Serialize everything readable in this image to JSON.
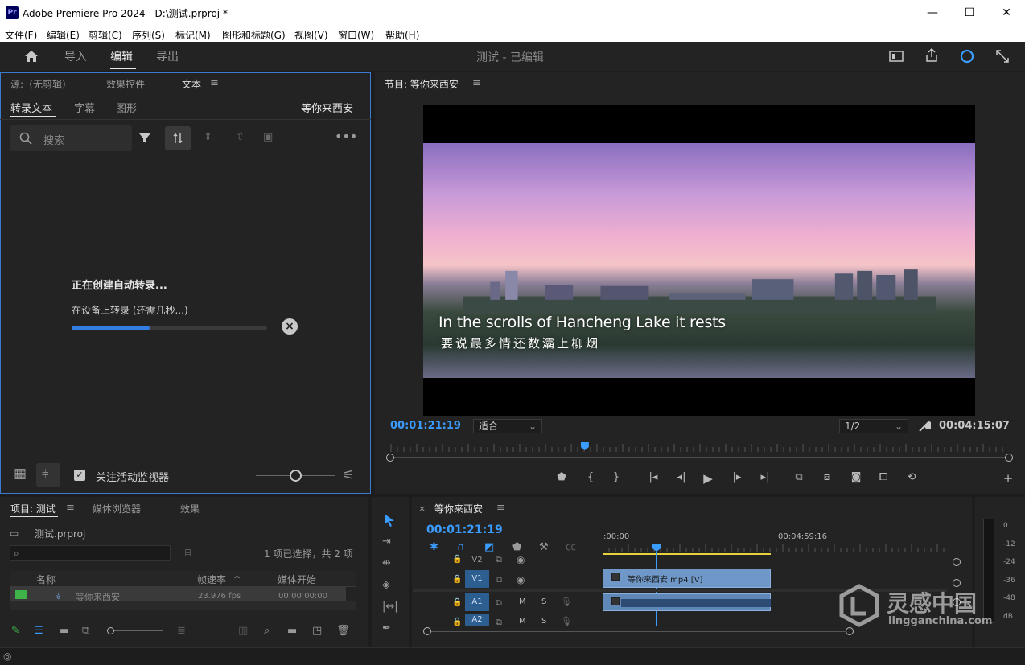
{
  "window": {
    "title": "Adobe Premiere Pro 2024 - D:\\测试.prproj *",
    "logo": "Pr",
    "minimize": "—",
    "maximize": "☐",
    "close": "✕"
  },
  "menu": [
    "文件(F)",
    "编辑(E)",
    "剪辑(C)",
    "序列(S)",
    "标记(M)",
    "图形和标题(G)",
    "视图(V)",
    "窗口(W)",
    "帮助(H)"
  ],
  "header": {
    "tabs": [
      "导入",
      "编辑",
      "导出"
    ],
    "active_tab": "编辑",
    "project_title": "测试 - 已编辑"
  },
  "source_panel": {
    "tabs": [
      "源:（无剪辑）",
      "效果控件",
      "文本"
    ],
    "active_tab": "文本",
    "subtabs": [
      "转录文本",
      "字幕",
      "图形"
    ],
    "active_subtab": "转录文本",
    "sequence_name": "等你来西安",
    "search_placeholder": "搜索",
    "status_title": "正在创建自动转录...",
    "status_detail": "在设备上转录 (还需几秒...)",
    "progress": 0.4,
    "follow_monitor_label": "关注活动监视器",
    "follow_monitor_checked": true
  },
  "program_monitor": {
    "title": "节目: 等你来西安",
    "caption_en": "In the scrolls of Hancheng Lake it rests",
    "caption_zh": "要说最多情还数灞上柳烟",
    "timecode_current": "00:01:21:19",
    "zoom": "适合",
    "resolution": "1/2",
    "timecode_duration": "00:04:15:07",
    "playhead_fraction": 0.315
  },
  "project_panel": {
    "tabs": [
      "项目: 测试",
      "媒体浏览器",
      "效果"
    ],
    "active_tab": "项目: 测试",
    "file": "测试.prproj",
    "selection_info": "1 项已选择，共 2 项",
    "columns": [
      "名称",
      "帧速率",
      "媒体开始"
    ],
    "rows": [
      {
        "name": "等你来西安",
        "fps": "23.976 fps",
        "start": "00:00:00:00"
      }
    ]
  },
  "timeline": {
    "sequence_name": "等你来西安",
    "timecode": "00:01:21:19",
    "ruler_start": ":00:00",
    "ruler_mark": "00:04:59:16",
    "tracks": [
      {
        "label": "V2",
        "type": "video"
      },
      {
        "label": "V1",
        "type": "video"
      },
      {
        "label": "A1",
        "type": "audio"
      },
      {
        "label": "A2",
        "type": "audio"
      }
    ],
    "clip_name": "等你来西安.mp4 [V]",
    "mute_label": "M",
    "solo_label": "S"
  },
  "meter": {
    "labels": [
      "0",
      "-12",
      "-24",
      "-36",
      "-48",
      "dB"
    ]
  },
  "watermark": {
    "main": "灵感中国",
    "sub": "lingganchina.com"
  },
  "colors": {
    "accent": "#3b9cff",
    "panel_bg": "#232323",
    "focus_border": "#3b7ad0",
    "clip": "#6f98c9"
  }
}
